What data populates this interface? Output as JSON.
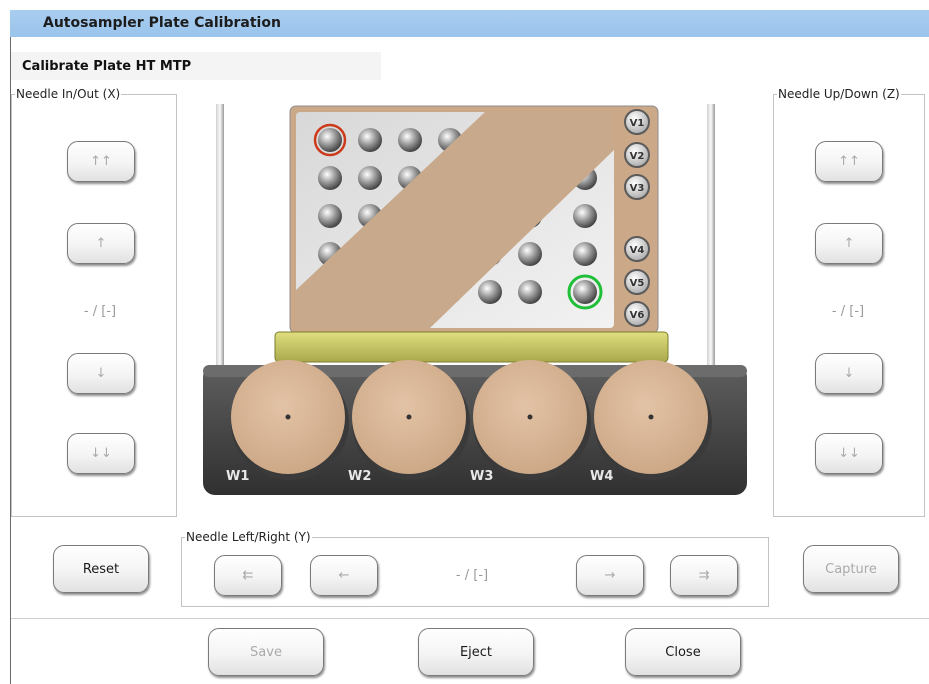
{
  "window": {
    "title": "Autosampler Plate Calibration"
  },
  "plate": {
    "subtitle": "Calibrate Plate HT MTP"
  },
  "needle_x": {
    "legend": "Needle In/Out (X)",
    "btn_fast_up": "↑↑",
    "btn_up": "↑",
    "value": "- / [-]",
    "btn_down": "↓",
    "btn_fast_down": "↓↓"
  },
  "needle_z": {
    "legend": "Needle Up/Down (Z)",
    "btn_fast_up": "↑↑",
    "btn_up": "↑",
    "value": "- / [-]",
    "btn_down": "↓",
    "btn_fast_down": "↓↓"
  },
  "needle_y": {
    "legend": "Needle Left/Right (Y)",
    "btn_fast_left": "⇇",
    "btn_left": "←",
    "value": "- / [-]",
    "btn_right": "→",
    "btn_fast_right": "⇉"
  },
  "vials": [
    "V1",
    "V2",
    "V3",
    "V4",
    "V5",
    "V6"
  ],
  "wash_stations": [
    "W1",
    "W2",
    "W3",
    "W4"
  ],
  "buttons": {
    "reset": "Reset",
    "capture": "Capture",
    "save": "Save",
    "eject": "Eject",
    "close": "Close"
  },
  "colors": {
    "title_bar": "#9ac4ec",
    "selected_well": "#cc3a1a",
    "target_well": "#1fbf3a",
    "sample_tape": "#c7a98a"
  }
}
